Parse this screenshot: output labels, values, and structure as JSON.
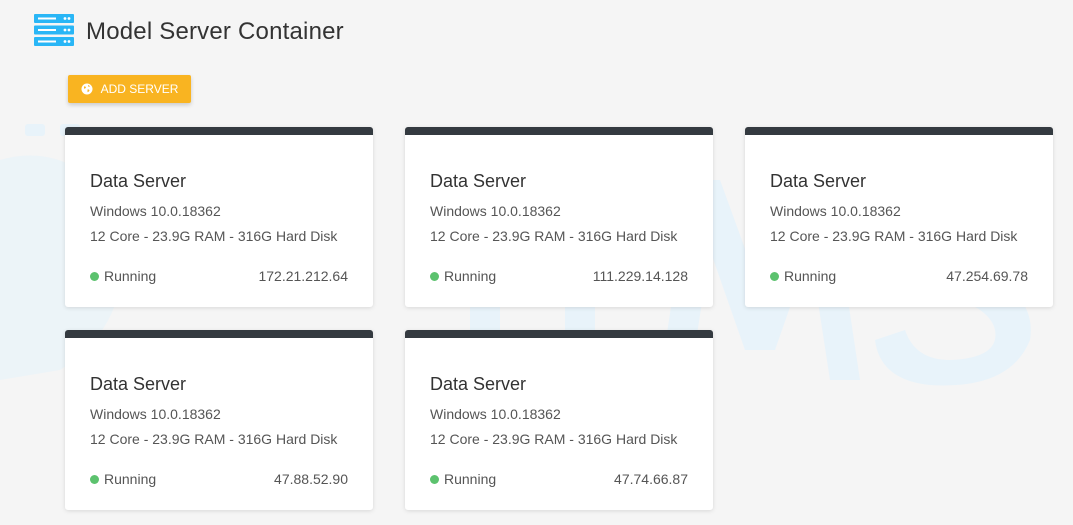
{
  "header": {
    "title": "Model Server Container",
    "icon": "server-stack-icon"
  },
  "toolbar": {
    "add_label": "ADD SERVER",
    "add_icon": "globe-icon",
    "accent": "#f9b421"
  },
  "servers": [
    {
      "name": "Data Server",
      "os": "Windows 10.0.18362",
      "specs": "12 Core - 23.9G RAM - 316G Hard Disk",
      "status": "Running",
      "ip": "172.21.212.64"
    },
    {
      "name": "Data Server",
      "os": "Windows 10.0.18362",
      "specs": "12 Core - 23.9G RAM - 316G Hard Disk",
      "status": "Running",
      "ip": "111.229.14.128"
    },
    {
      "name": "Data Server",
      "os": "Windows 10.0.18362",
      "specs": "12 Core - 23.9G RAM - 316G Hard Disk",
      "status": "Running",
      "ip": "47.254.69.78"
    },
    {
      "name": "Data Server",
      "os": "Windows 10.0.18362",
      "specs": "12 Core - 23.9G RAM - 316G Hard Disk",
      "status": "Running",
      "ip": "47.88.52.90"
    },
    {
      "name": "Data Server",
      "os": "Windows 10.0.18362",
      "specs": "12 Core - 23.9G RAM - 316G Hard Disk",
      "status": "Running",
      "ip": "47.74.66.87"
    }
  ],
  "colors": {
    "running": "#5cc26e",
    "card_top": "#343a40",
    "icon": "#29b6f6"
  }
}
